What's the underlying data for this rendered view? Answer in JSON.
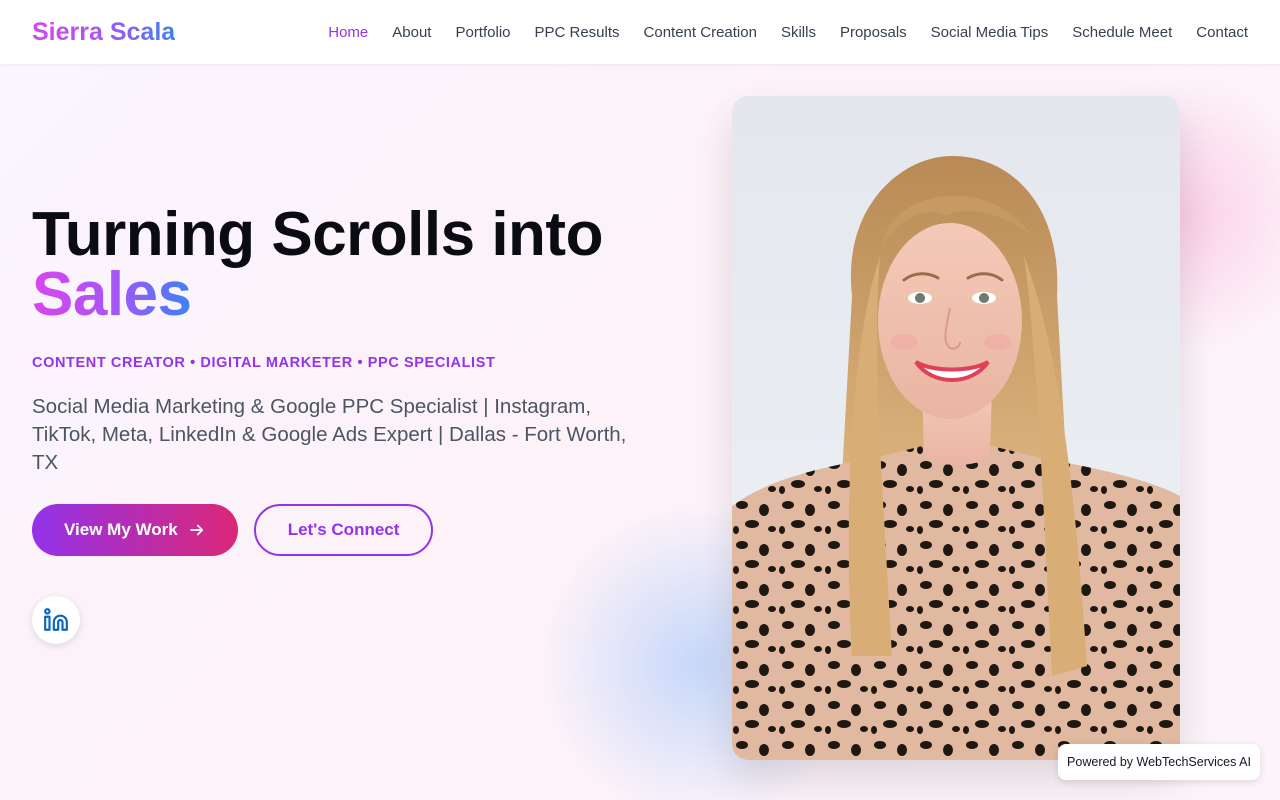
{
  "header": {
    "brand": "Sierra Scala",
    "nav": [
      {
        "label": "Home",
        "active": true
      },
      {
        "label": "About"
      },
      {
        "label": "Portfolio"
      },
      {
        "label": "PPC Results"
      },
      {
        "label": "Content Creation"
      },
      {
        "label": "Skills"
      },
      {
        "label": "Proposals"
      },
      {
        "label": "Social Media Tips"
      },
      {
        "label": "Schedule Meet"
      },
      {
        "label": "Contact"
      }
    ]
  },
  "hero": {
    "headline_line1": "Turning Scrolls into",
    "headline_accent": "Sales",
    "roles": "CONTENT CREATOR • DIGITAL MARKETER • PPC SPECIALIST",
    "tagline": "Social Media Marketing & Google PPC Specialist | Instagram, TikTok, Meta, LinkedIn & Google Ads Expert | Dallas - Fort Worth, TX",
    "primary_cta": "View My Work",
    "secondary_cta": "Let's Connect",
    "social_icon": "linkedin-icon"
  },
  "badge": {
    "text": "Powered by WebTechServices AI"
  },
  "colors": {
    "accent_purple": "#9333ea",
    "accent_pink": "#db2777",
    "accent_blue": "#3b82f6",
    "linkedin_blue": "#0a66c2"
  }
}
